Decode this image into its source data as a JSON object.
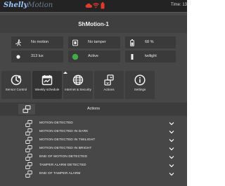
{
  "header": {
    "logo_text": "Shelly",
    "logo_sub": "Motion",
    "time_label": "Time: 13",
    "status_icons": [
      "cloud-icon",
      "wifi-icon",
      "battery-icon"
    ],
    "colors": {
      "status_red": "#e23a2c",
      "logo_blue": "#9fc6ff"
    }
  },
  "device": {
    "title": "ShMotion-1"
  },
  "stats": [
    {
      "icon": "running-person-icon",
      "text": "No motion"
    },
    {
      "icon": "tamper-icon",
      "text": "No tamper"
    },
    {
      "icon": "battery-icon",
      "text": "68 %"
    },
    {
      "icon": "lux-icon",
      "text": "313 lux"
    },
    {
      "icon": "active-status-icon",
      "text": "Active",
      "color": "#3fae49"
    },
    {
      "icon": "brightness-icon",
      "text": "twilight"
    }
  ],
  "tiles": [
    {
      "icon": "sensor-control-icon",
      "label": "Sensor Control"
    },
    {
      "icon": "weekly-schedule-icon",
      "label": "Weekly schedule"
    },
    {
      "icon": "globe-icon",
      "label": "Internet & Security"
    },
    {
      "icon": "actions-icon",
      "label": "Actions"
    },
    {
      "icon": "info-icon",
      "label": "Settings"
    }
  ],
  "actions": {
    "title": "Actions",
    "items": [
      "MOTION DETECTED",
      "MOTION DETECTED IN DARK",
      "MOTION DETECTED IN TWILIGHT",
      "MOTION DETECTED IN BRIGHT",
      "END OF MOTION DETECTED",
      "TAMPER ALARM DETECTED",
      "END OF TAMPER ALARM"
    ]
  }
}
